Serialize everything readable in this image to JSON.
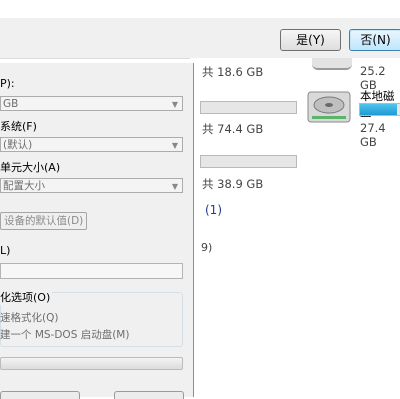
{
  "message_box": {
    "yes_label": "是(Y)",
    "no_label": "否(N)"
  },
  "explorer": {
    "drives": [
      {
        "total_text": "共 18.6 GB",
        "free_text": ""
      },
      {
        "total_text": "共 74.4 GB",
        "free_text": ""
      },
      {
        "total_text": "共 38.9 GB",
        "free_text": ""
      }
    ],
    "side_drives": [
      {
        "size_text": "25.2 GB"
      },
      {
        "name": "本地磁盘",
        "size_text": "27.4 GB",
        "used_fraction": 0.9
      }
    ],
    "group_count": "(1)",
    "paren_fragment": "9)"
  },
  "format_dialog": {
    "capacity_label": "P):",
    "capacity_value": "GB",
    "filesystem_label": "系统(F)",
    "filesystem_value": "(默认)",
    "unit_size_label": "单元大小(A)",
    "unit_size_value": "配置大小",
    "restore_defaults_label": "设备的默认值(D)",
    "volume_label_label": "L)",
    "volume_label_value": "",
    "format_options_label": "化选项(O)",
    "quick_format_label": "速格式化(Q)",
    "msdos_disk_label": "建一个 MS-DOS 启动盘(M)"
  },
  "colors": {
    "accent": "#3c7fb1",
    "progress": "#1e9bd3",
    "dialog_bg": "#f0f0f0"
  }
}
